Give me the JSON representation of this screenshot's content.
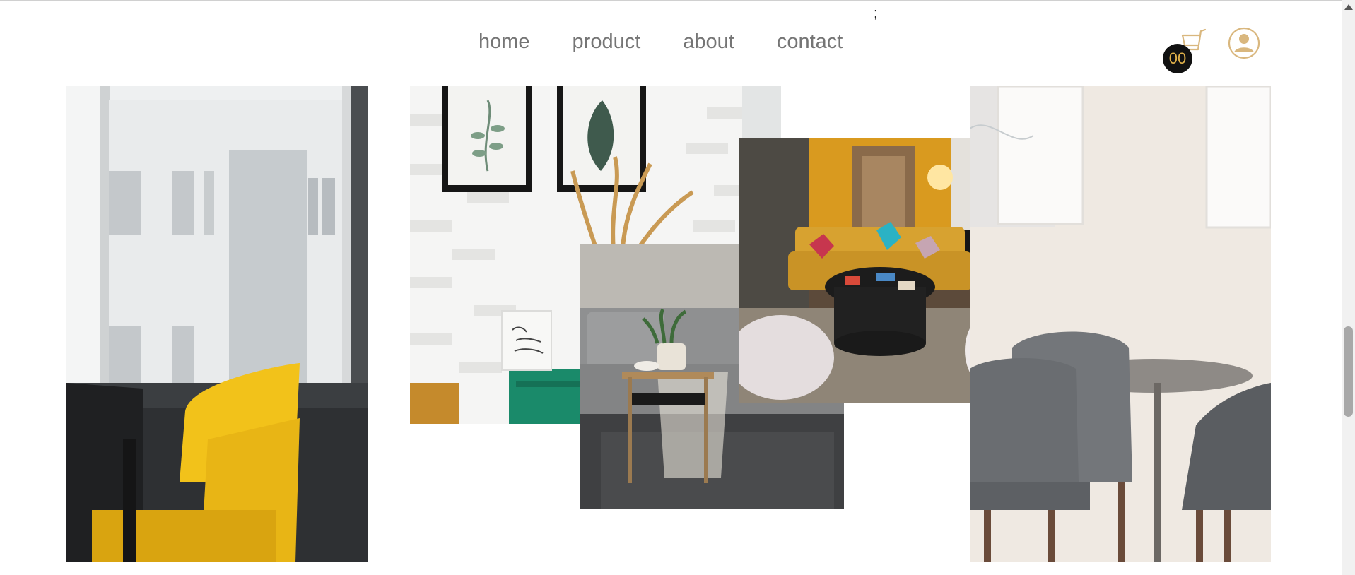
{
  "stray_text": ";",
  "nav": {
    "items": [
      {
        "label": "home"
      },
      {
        "label": "product"
      },
      {
        "label": "about"
      },
      {
        "label": "contact"
      }
    ]
  },
  "cart": {
    "count": "00",
    "icon": "cart-icon"
  },
  "user": {
    "icon": "user-circle-icon"
  },
  "colors": {
    "accent": "#d9b77e",
    "badge_bg": "#111111",
    "badge_text": "#e0b14a",
    "nav_text": "#757575"
  },
  "photos": [
    {
      "name": "photo-yellow-chair-window"
    },
    {
      "name": "photo-brick-wall-frames"
    },
    {
      "name": "photo-grey-sofa-side-table"
    },
    {
      "name": "photo-mustard-sofa-lounge"
    },
    {
      "name": "photo-grey-dining-chairs"
    }
  ]
}
